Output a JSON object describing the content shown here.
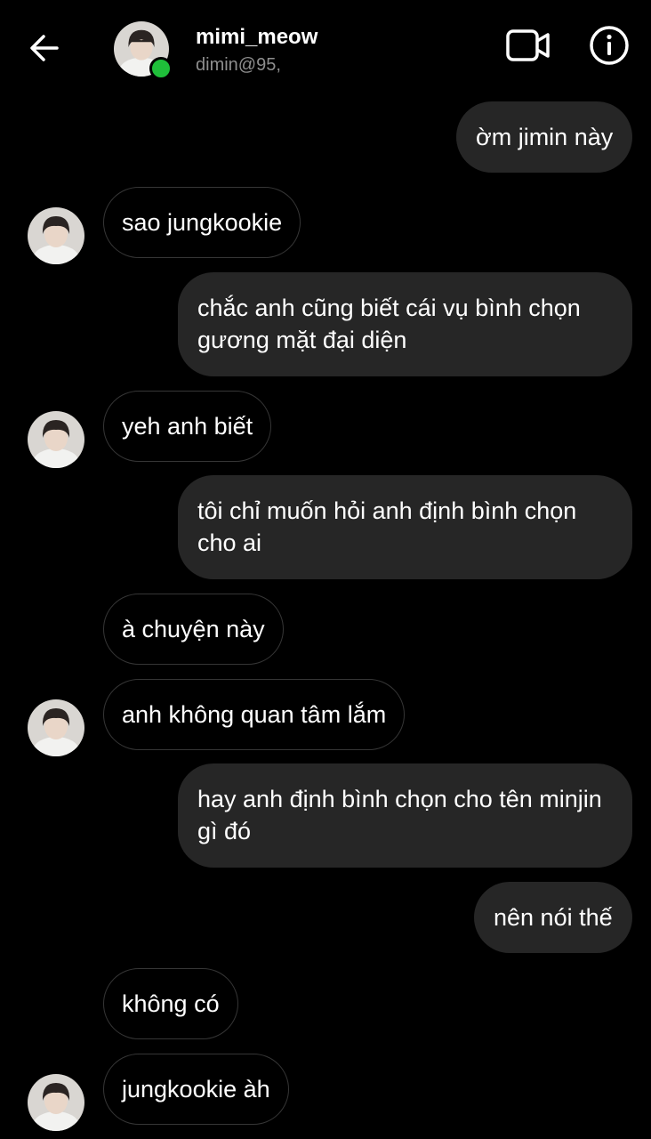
{
  "header": {
    "contact_name": "mimi_meow",
    "contact_handle": "dimin@95,",
    "back_icon": "arrow-left-icon",
    "video_icon": "video-camera-icon",
    "info_icon": "info-icon",
    "online_color": "#1fbf3a"
  },
  "messages": [
    {
      "direction": "out",
      "text": "ờm jimin này"
    },
    {
      "direction": "in",
      "text": "sao jungkookie",
      "avatar": true
    },
    {
      "direction": "out",
      "text": "chắc anh cũng biết cái vụ bình chọn gương mặt đại diện"
    },
    {
      "direction": "in",
      "text": "yeh anh biết",
      "avatar": true
    },
    {
      "direction": "out",
      "text": "tôi chỉ muốn hỏi anh định bình chọn cho ai"
    },
    {
      "direction": "in",
      "text": "à chuyện này",
      "avatar": false
    },
    {
      "direction": "in",
      "text": "anh không quan tâm lắm",
      "avatar": true
    },
    {
      "direction": "out",
      "text": "hay anh định bình chọn cho tên minjin gì đó"
    },
    {
      "direction": "out",
      "text": "nên nói thế"
    },
    {
      "direction": "in",
      "text": "không có",
      "avatar": false
    },
    {
      "direction": "in",
      "text": "jungkookie àh",
      "avatar": true
    }
  ],
  "colors": {
    "background": "#000000",
    "outgoing_bubble": "#262626",
    "incoming_border": "#363636",
    "secondary_text": "#8e8e8e"
  }
}
